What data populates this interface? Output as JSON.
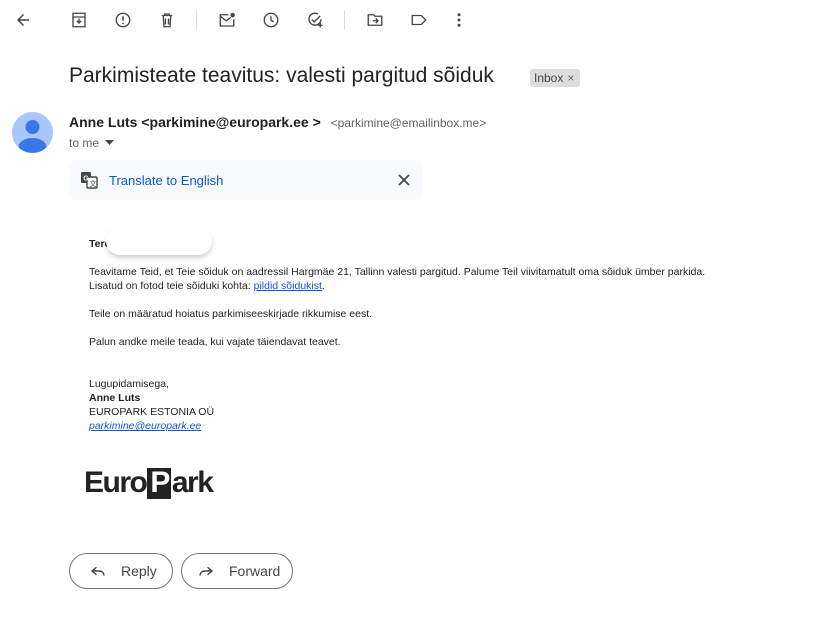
{
  "toolbar": {
    "icons": [
      "back-arrow-icon",
      "archive-icon",
      "report-spam-icon",
      "delete-icon",
      "mark-unread-icon",
      "snooze-icon",
      "add-to-tasks-icon",
      "move-to-icon",
      "label-icon",
      "more-vert-icon"
    ]
  },
  "email": {
    "subject": "Parkimisteate teavitus: valesti pargitud sõiduk",
    "label_chip": "Inbox",
    "label_chip_close": "×",
    "sender_name": "Anne Luts",
    "sender_email_display": "<parkimine@europark.ee >",
    "sender_email_actual": "<parkimine@emailinbox.me>",
    "to": "to me"
  },
  "translate": {
    "label": "Translate to English"
  },
  "body": {
    "greeting": "Tere",
    "para1_line1": "Teavitame Teid, et Teie sõiduk on aadressil Hargmäe 21, Tallinn valesti pargitud. Palume Teil viivitamatult oma sõiduk ümber parkida.",
    "para1_line2_prefix": "Lisatud on fotod teie sõiduki kohta: ",
    "para1_link": "pildid sõidukist",
    "para1_line2_suffix": ".",
    "para2": "Teile on määratud hoiatus parkimiseeskirjade rikkumise eest.",
    "para3": "Palun andke meile teada, kui vajate täiendavat teavet.",
    "closing": "Lugupidamisega,",
    "sig_name": "Anne Luts",
    "sig_company": "EUROPARK ESTONIA OÜ",
    "sig_email": "parkimine@europark.ee",
    "logo_left": "Euro",
    "logo_p": "P",
    "logo_right": "ark"
  },
  "actions": {
    "reply": "Reply",
    "forward": "Forward"
  },
  "colors": {
    "link": "#1155cc",
    "translate_link": "#0b57d0",
    "avatar_bg": "#a8c7fa",
    "avatar_fg": "#3b78e7"
  }
}
